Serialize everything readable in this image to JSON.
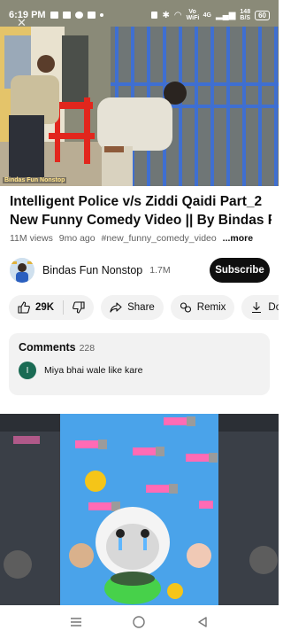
{
  "status_bar": {
    "time": "6:19 PM",
    "volte": "Vo WiFi",
    "network": "4G",
    "speed_top": "148",
    "speed_bottom": "B/S",
    "battery": "60"
  },
  "video": {
    "watermark": "Bindas Fun Nonstop"
  },
  "title": {
    "line1": "Intelligent Police v/s Ziddi Qaidi Part_2",
    "line2": "New Funny Comedy Video || By Bindas F..."
  },
  "meta": {
    "views": "11M views",
    "age": "9mo ago",
    "hashtag": "#new_funny_comedy_video",
    "more": "...more"
  },
  "channel": {
    "name": "Bindas Fun Nonstop",
    "subscribers": "1.7M",
    "subscribe_label": "Subscribe"
  },
  "actions": {
    "like_count": "29K",
    "share_label": "Share",
    "remix_label": "Remix",
    "download_label": "Downlo"
  },
  "comments": {
    "title": "Comments",
    "count": "228",
    "first_avatar_letter": "I",
    "first_text": "Miya bhai wale like kare"
  },
  "colors": {
    "subscribe_bg": "#0f0f0f",
    "chip_bg": "#f2f2f2",
    "comment_avatar": "#1a6b54",
    "next_video_blue": "#4aa3ea"
  }
}
